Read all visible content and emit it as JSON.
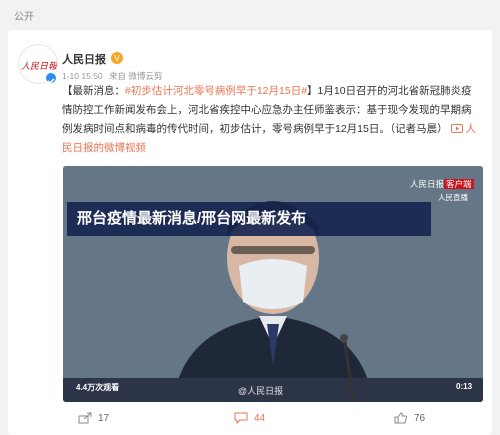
{
  "header": {
    "label": "公开"
  },
  "post": {
    "author": "人民日报",
    "avatar_text": "人民日報",
    "meta": {
      "time": "1-10 15:50",
      "source": "来自 微博云剪"
    },
    "text_prefix": "【最新消息：",
    "hashtag": "#初步估计河北零号病例早于12月15日#",
    "text_body": "】1月10日召开的河北省新冠肺炎疫情防控工作新闻发布会上，河北省疾控中心应急办主任师鉴表示：基于现今发现的早期病例发病时间点和病毒的传代时间，初步估计，零号病例早于12月15日。（记者马晨）",
    "video_link": "人民日报的微博视频"
  },
  "video": {
    "overlay_title": "邢台疫情最新消息/邢台网最新发布",
    "views": "4.4万次观看",
    "duration": "0:13",
    "watermark": "@人民日报",
    "channel_logo": "人民日报",
    "channel_logo_suffix": "客户端",
    "channel_sub": "人民直播"
  },
  "actions": {
    "shares": "17",
    "comments": "44",
    "likes": "76"
  },
  "colors": {
    "accent": "#eb7350",
    "overlay": "#142450",
    "verified": "#2d8cf0"
  }
}
